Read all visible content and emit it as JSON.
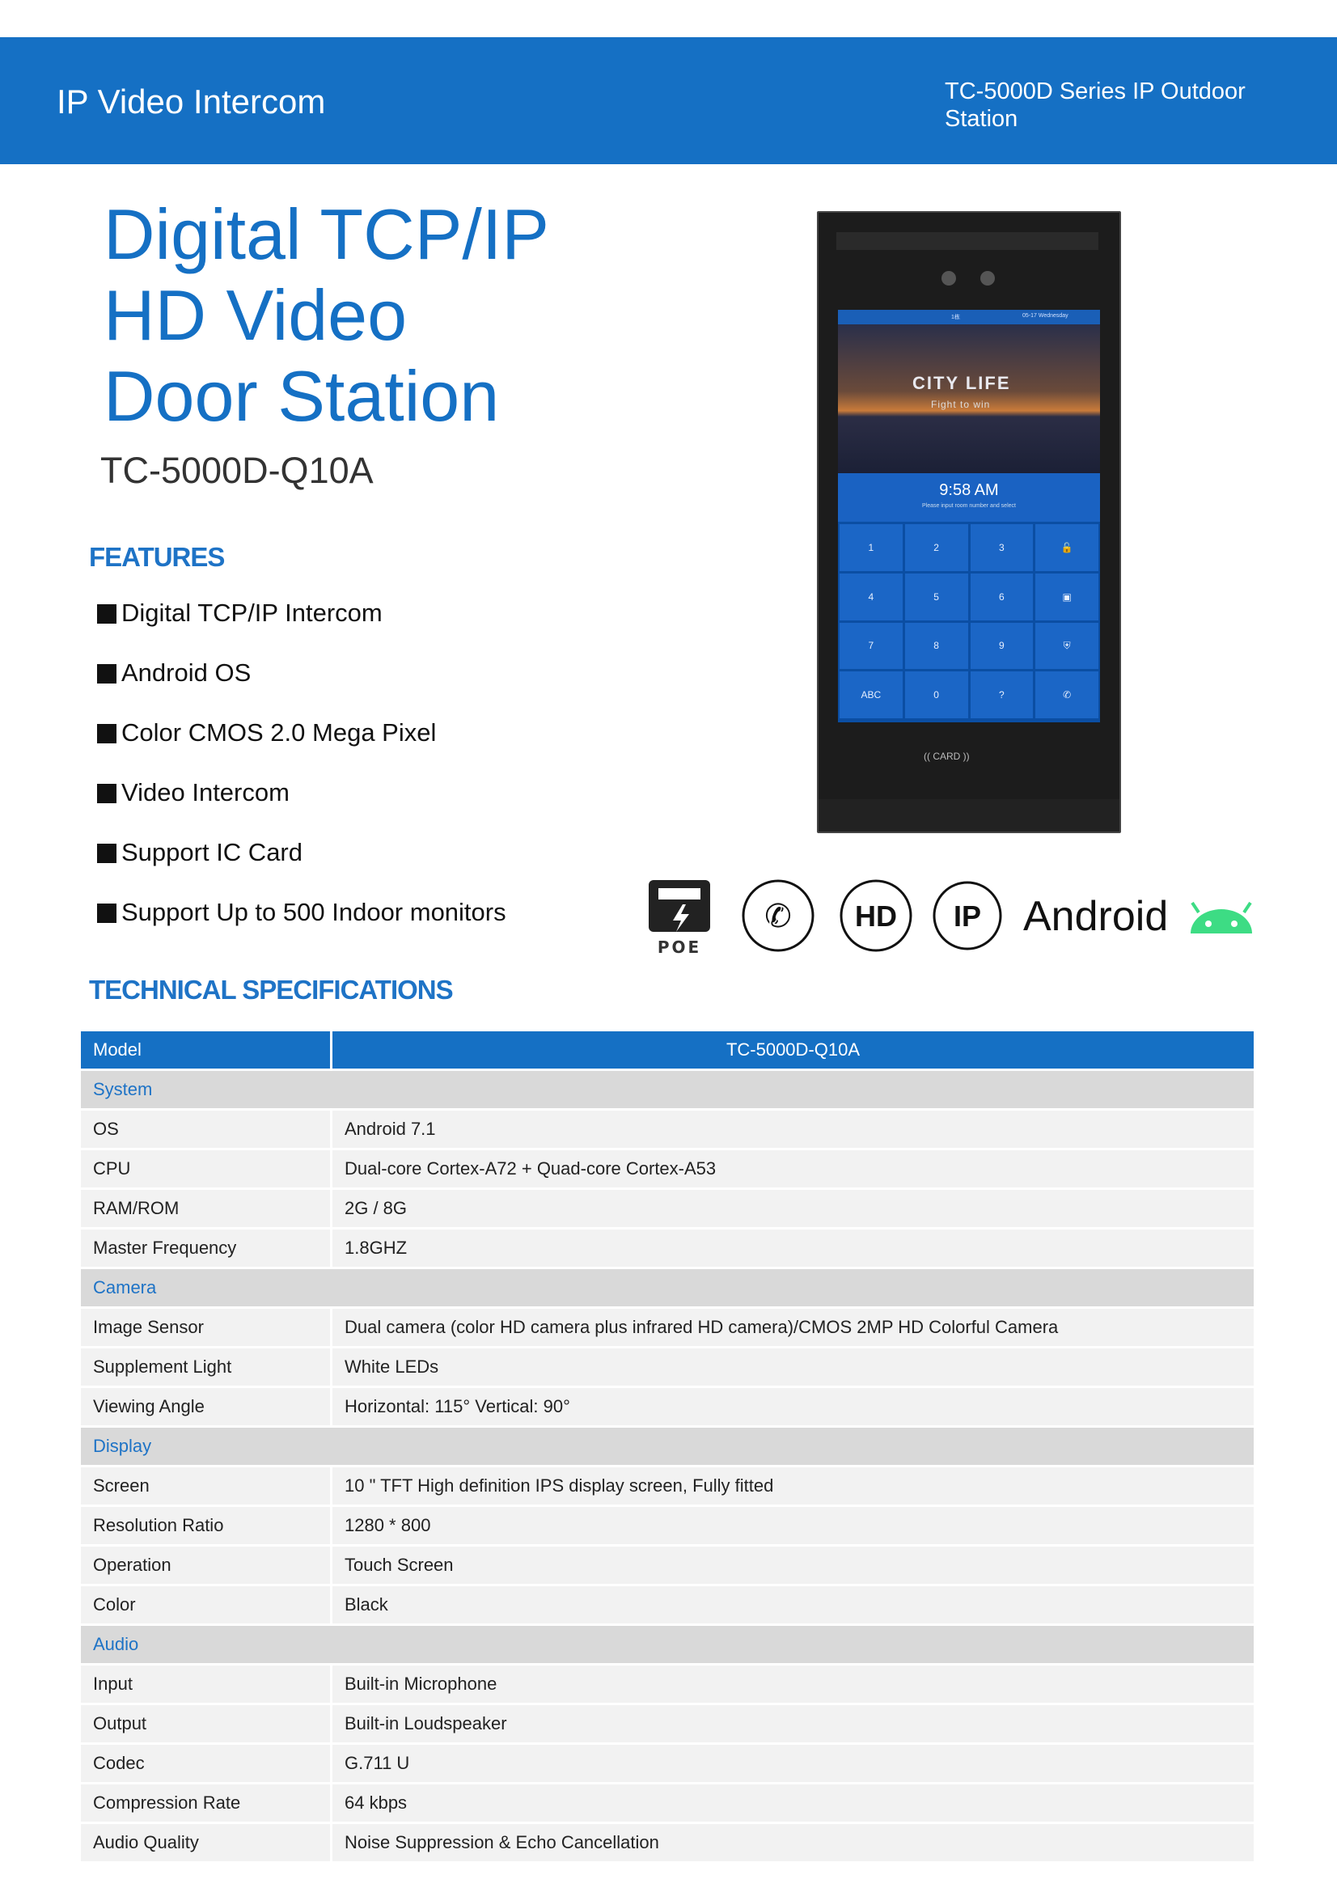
{
  "header": {
    "left_title": "IP Video  Intercom",
    "right_title": "TC-5000D Series  IP  Outdoor\nStation"
  },
  "hero": {
    "title_lines": [
      "Digital TCP/IP",
      "HD Video",
      "Door Station"
    ],
    "model": "TC-5000D-Q10A"
  },
  "features": {
    "heading": "FEATURES",
    "items": [
      "Digital TCP/IP Intercom",
      "Android OS",
      "Color CMOS 2.0 Mega Pixel",
      "Video Intercom",
      "Support  IC  Card",
      "Support Up to 500 Indoor monitors"
    ]
  },
  "badges": {
    "poe_label": "POE",
    "hd_label": "HD",
    "ip_label": "IP",
    "android_label": "Android"
  },
  "device_screen": {
    "status_center": "1栋",
    "status_right": "05-17 Wednesday",
    "city": "CITY LIFE",
    "slogan": "Fight to win",
    "time": "9:58 AM",
    "hint": "Please input room number and select",
    "keys": [
      "1",
      "2",
      "3",
      "",
      "4",
      "5",
      "6",
      "",
      "7",
      "8",
      "9",
      "",
      "ABC",
      "0",
      "",
      ""
    ],
    "card": "CARD"
  },
  "specs": {
    "heading": "TECHNICAL SPECIFICATIONS",
    "header": {
      "label": "Model",
      "value": "TC-5000D-Q10A"
    },
    "groups": [
      {
        "name": "System",
        "rows": [
          [
            "OS",
            "Android 7.1"
          ],
          [
            "CPU",
            "Dual-core Cortex-A72 + Quad-core Cortex-A53"
          ],
          [
            "RAM/ROM",
            "2G / 8G"
          ],
          [
            "Master Frequency",
            "1.8GHZ"
          ]
        ]
      },
      {
        "name": "Camera",
        "rows": [
          [
            "Image Sensor",
            "Dual camera  (color  HD camera  plus infrared  HD camera)/CMOS 2MP  HD Colorful Camera"
          ],
          [
            "Supplement  Light",
            "White  LEDs"
          ],
          [
            "Viewing Angle",
            "Horizontal:  115°  Vertical: 90°"
          ]
        ]
      },
      {
        "name": "Display",
        "rows": [
          [
            "Screen",
            "10 \" TFT High definition IPS display screen, Fully fitted"
          ],
          [
            "Resolution Ratio",
            "1280 * 800"
          ],
          [
            "Operation",
            "Touch Screen"
          ],
          [
            "Color",
            "Black"
          ]
        ]
      },
      {
        "name": "Audio",
        "rows": [
          [
            "Input",
            "Built-in  Microphone"
          ],
          [
            "Output",
            "Built-in  Loudspeaker"
          ],
          [
            "Codec",
            "G.711  U"
          ],
          [
            "Compression  Rate",
            "64  kbps"
          ],
          [
            "Audio Quality",
            "Noise Suppression &  Echo Cancellation"
          ]
        ]
      }
    ]
  }
}
